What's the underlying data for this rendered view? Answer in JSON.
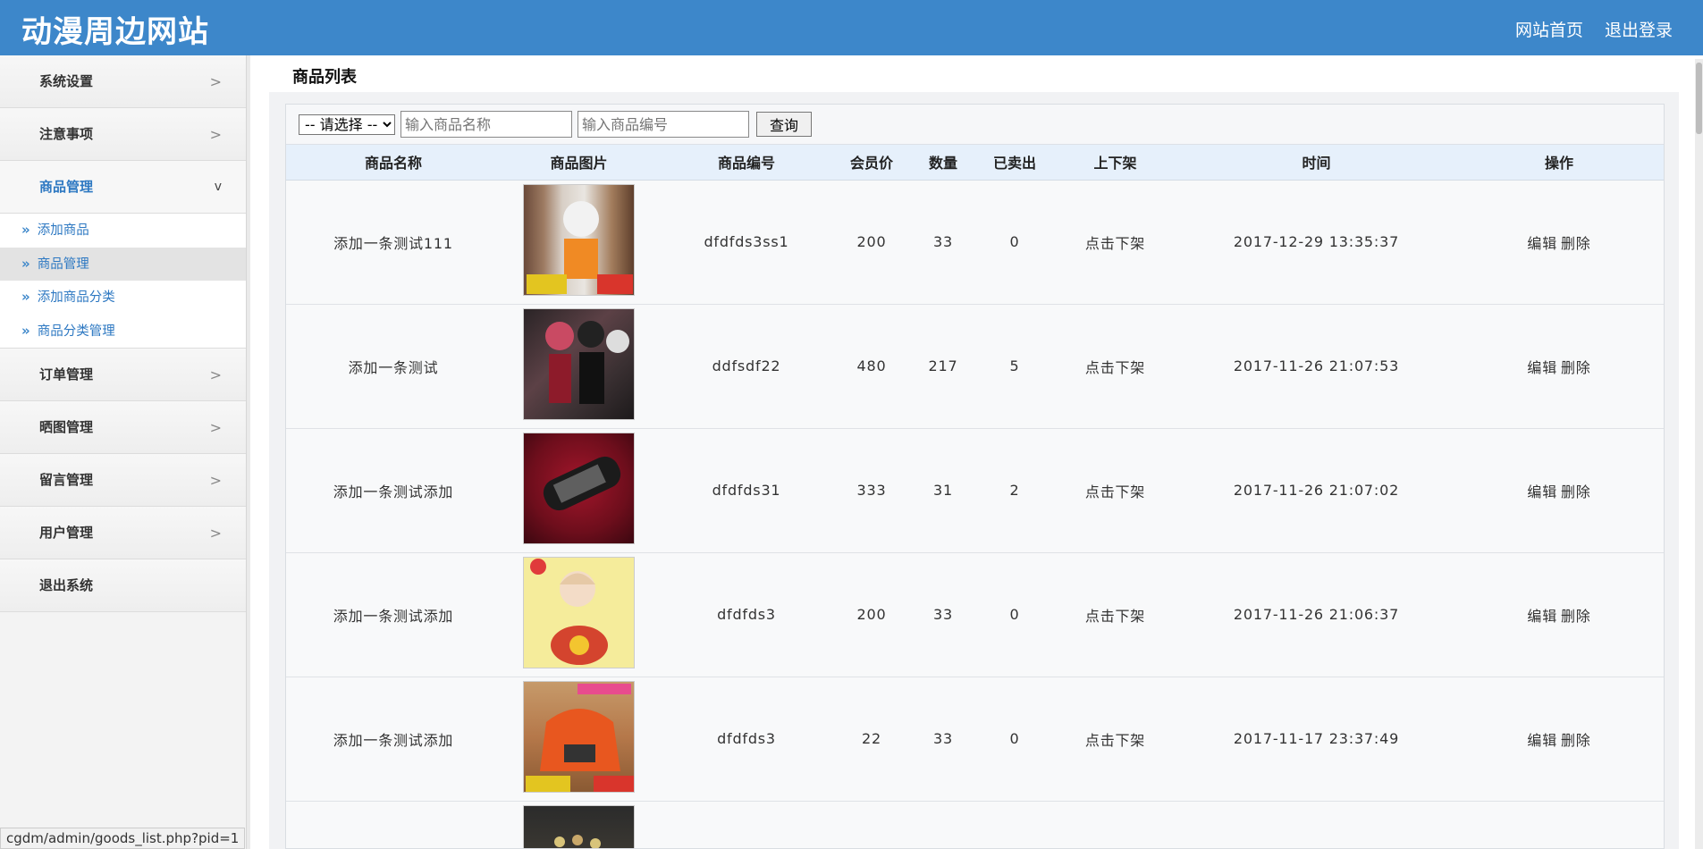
{
  "header": {
    "site_title": "动漫周边网站",
    "link_home": "网站首页",
    "link_logout": "退出登录"
  },
  "sidebar": {
    "items": [
      {
        "label": "系统设置",
        "chev": ">"
      },
      {
        "label": "注意事项",
        "chev": ">"
      },
      {
        "label": "商品管理",
        "chev": "v"
      },
      {
        "label": "订单管理",
        "chev": ">"
      },
      {
        "label": "晒图管理",
        "chev": ">"
      },
      {
        "label": "留言管理",
        "chev": ">"
      },
      {
        "label": "用户管理",
        "chev": ">"
      },
      {
        "label": "退出系统",
        "chev": ""
      }
    ],
    "subitems": [
      {
        "label": "添加商品"
      },
      {
        "label": "商品管理"
      },
      {
        "label": "添加商品分类"
      },
      {
        "label": "商品分类管理"
      }
    ],
    "sub_arrow": "»"
  },
  "status_url": "cgdm/admin/goods_list.php?pid=1",
  "main": {
    "title": "商品列表",
    "search": {
      "select_value": "-- 请选择 --",
      "name_placeholder": "输入商品名称",
      "code_placeholder": "输入商品编号",
      "query_label": "查询"
    },
    "columns": [
      "商品名称",
      "商品图片",
      "商品编号",
      "会员价",
      "数量",
      "已卖出",
      "上下架",
      "时间",
      "操作"
    ],
    "rows": [
      {
        "name": "添加一条测试111",
        "code": "dfdfds3ss1",
        "price": "200",
        "qty": "33",
        "sold": "0",
        "toggle": "点击下架",
        "time": "2017-12-29 13:35:37",
        "edit": "编辑",
        "del": "删除"
      },
      {
        "name": "添加一条测试",
        "code": "ddfsdf22",
        "price": "480",
        "qty": "217",
        "sold": "5",
        "toggle": "点击下架",
        "time": "2017-11-26 21:07:53",
        "edit": "编辑",
        "del": "删除"
      },
      {
        "name": "添加一条测试添加",
        "code": "dfdfds31",
        "price": "333",
        "qty": "31",
        "sold": "2",
        "toggle": "点击下架",
        "time": "2017-11-26 21:07:02",
        "edit": "编辑",
        "del": "删除"
      },
      {
        "name": "添加一条测试添加",
        "code": "dfdfds3",
        "price": "200",
        "qty": "33",
        "sold": "0",
        "toggle": "点击下架",
        "time": "2017-11-26 21:06:37",
        "edit": "编辑",
        "del": "删除"
      },
      {
        "name": "添加一条测试添加",
        "code": "dfdfds3",
        "price": "22",
        "qty": "33",
        "sold": "0",
        "toggle": "点击下架",
        "time": "2017-11-17 23:37:49",
        "edit": "编辑",
        "del": "删除"
      }
    ]
  },
  "colors": {
    "header_bg": "#3d87ca",
    "link_blue": "#2d78c2",
    "table_head_bg": "#e6f0fb"
  }
}
